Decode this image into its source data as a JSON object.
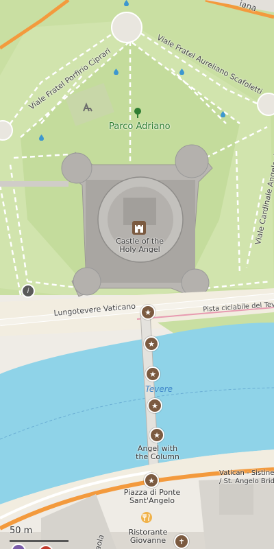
{
  "map": {
    "park_label": "Parco Adriano",
    "castle_label_line1": "Castle of the",
    "castle_label_line2": "Holy Angel",
    "river_label": "Tevere",
    "roads": {
      "viale_porfirio": "Viale Fratel Porfirio Ciprari",
      "viale_aureliano": "Viale Fratel Aureliano Scafoletti",
      "viale_cardinale": "Viale Cardinale Angelo dell'A",
      "lungotevere": "Lungotevere Vaticano",
      "pista": "Pista ciclabile del Tevere",
      "top_right": "iana",
      "bottom_left": "aola"
    },
    "pois": {
      "angel_column_line1": "Angel with",
      "angel_column_line2": "the Column",
      "piazza_line1": "Piazza di Ponte",
      "piazza_line2": "Sant'Angelo",
      "vatican_line1": "Vatican - Sistine C",
      "vatican_line2": "/ St. Angelo Bridge",
      "ristorante_line1": "Ristorante",
      "ristorante_line2": "Giovanne"
    },
    "scale_label": "50 m",
    "colors": {
      "park": "#c9dfa2",
      "park_light": "#d9e8bd",
      "river": "#8fd3e8",
      "road_orange": "#f39a3d",
      "castle": "#a8a8a8",
      "poi_brown": "#7b5a40"
    }
  }
}
